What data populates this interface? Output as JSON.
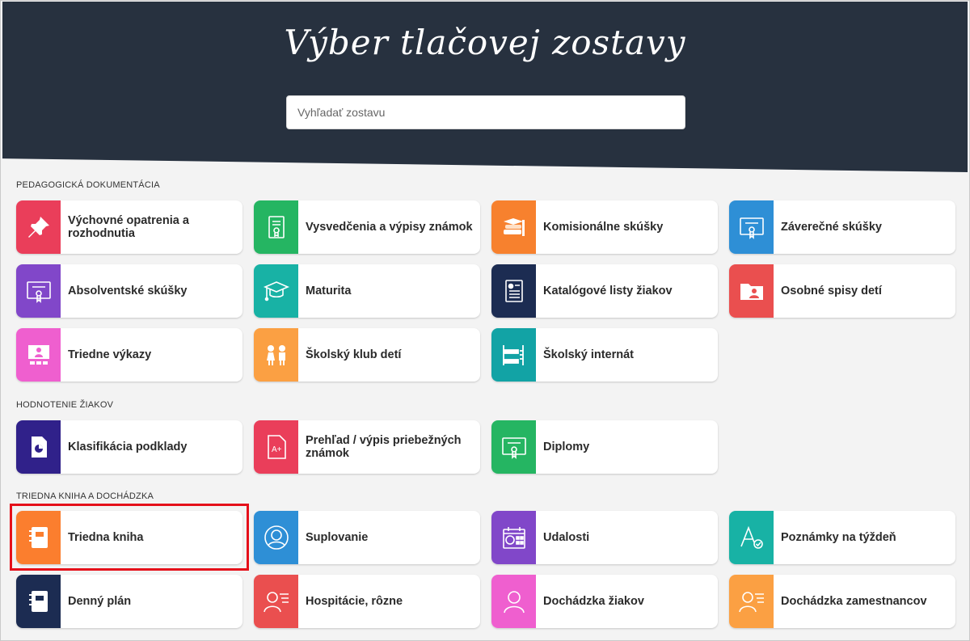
{
  "header": {
    "title": "Výber tlačovej zostavy",
    "search_placeholder": "Vyhľadať zostavu"
  },
  "sections": [
    {
      "title": "PEDAGOGICKÁ DOKUMENTÁCIA",
      "tiles": [
        {
          "label": "Výchovné opatrenia a rozhodnutia",
          "icon": "pin-icon",
          "color": "#ea3e5a"
        },
        {
          "label": "Vysvedčenia a výpisy známok",
          "icon": "certificate-icon",
          "color": "#25b562"
        },
        {
          "label": "Komisionálne skúšky",
          "icon": "books-icon",
          "color": "#f7812e"
        },
        {
          "label": "Záverečné skúšky",
          "icon": "diploma-icon",
          "color": "#2e8fd6"
        },
        {
          "label": "Absolventské skúšky",
          "icon": "diploma-icon",
          "color": "#8147c9"
        },
        {
          "label": "Maturita",
          "icon": "graduation-cap-icon",
          "color": "#18b2a5"
        },
        {
          "label": "Katalógové listy žiakov",
          "icon": "document-id-icon",
          "color": "#1c2c52"
        },
        {
          "label": "Osobné spisy detí",
          "icon": "folder-person-icon",
          "color": "#ea4f4f"
        },
        {
          "label": "Triedne výkazy",
          "icon": "classroom-icon",
          "color": "#ef5fcf"
        },
        {
          "label": "Školský klub detí",
          "icon": "children-icon",
          "color": "#fba043"
        },
        {
          "label": "Školský internát",
          "icon": "bunk-bed-icon",
          "color": "#12a3a5"
        }
      ]
    },
    {
      "title": "HODNOTENIE ŽIAKOV",
      "tiles": [
        {
          "label": "Klasifikácia podklady",
          "icon": "pie-document-icon",
          "color": "#30218a"
        },
        {
          "label": "Prehľad / výpis priebežných známok",
          "icon": "grade-document-icon",
          "color": "#ea3e5a"
        },
        {
          "label": "Diplomy",
          "icon": "diploma-icon",
          "color": "#25b562"
        }
      ]
    },
    {
      "title": "TRIEDNA KNIHA A DOCHÁDZKA",
      "tiles": [
        {
          "label": "Triedna kniha",
          "icon": "notebook-icon",
          "color": "#fb7e2e"
        },
        {
          "label": "Suplovanie",
          "icon": "person-circle-icon",
          "color": "#2e8fd6"
        },
        {
          "label": "Udalosti",
          "icon": "calendar-icon",
          "color": "#8147c9"
        },
        {
          "label": "Poznámky na týždeň",
          "icon": "font-check-icon",
          "color": "#18b2a5"
        },
        {
          "label": "Denný plán",
          "icon": "notebook-icon",
          "color": "#1c2c52"
        },
        {
          "label": "Hospitácie, rôzne",
          "icon": "person-list-icon",
          "color": "#ea4f4f"
        },
        {
          "label": "Dochádzka žiakov",
          "icon": "person-icon",
          "color": "#ef5fcf"
        },
        {
          "label": "Dochádzka zamestnancov",
          "icon": "person-list-icon",
          "color": "#fba043"
        }
      ]
    }
  ]
}
